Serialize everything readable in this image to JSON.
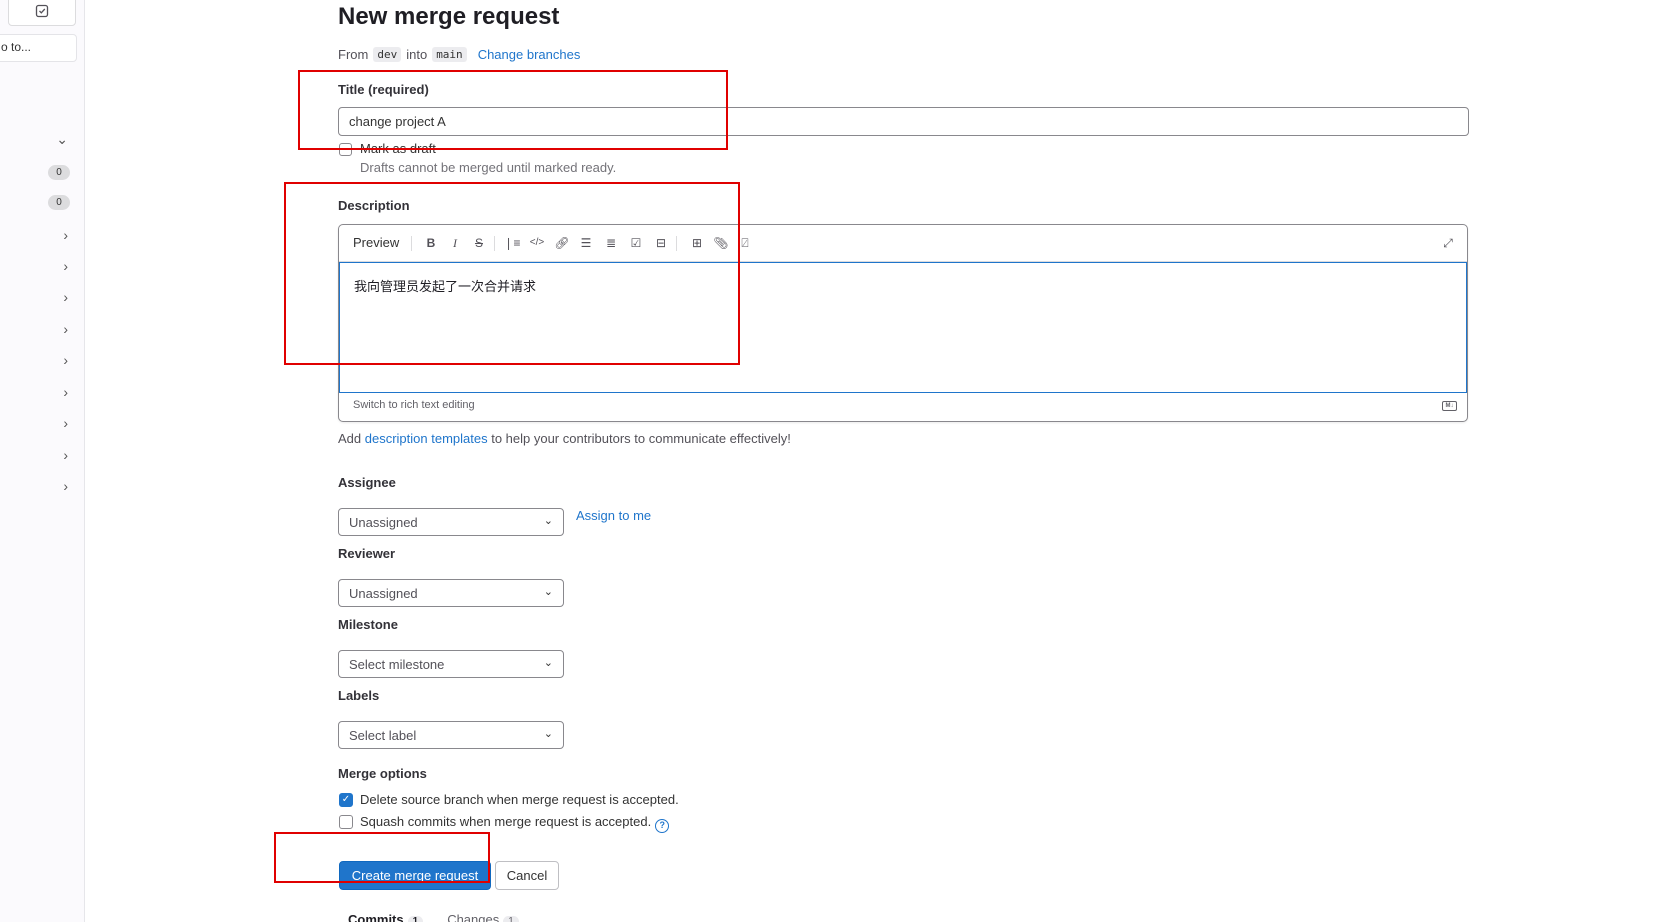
{
  "sidebar": {
    "search_text": "o to...",
    "badges": [
      "0",
      "0"
    ]
  },
  "header": {
    "title": "New merge request",
    "from_label": "From",
    "source_branch": "dev",
    "into_label": "into",
    "target_branch": "main",
    "change_branches": "Change branches"
  },
  "form": {
    "title_label": "Title (required)",
    "title_value": "change project A",
    "draft_label": "Mark as draft",
    "draft_help": "Drafts cannot be merged until marked ready.",
    "description_label": "Description",
    "preview_label": "Preview",
    "description_value": "我向管理员发起了一次合并请求",
    "switch_rich_text": "Switch to rich text editing",
    "md_badge": "M↓",
    "add_desc_prefix": "Add ",
    "add_desc_link": "description templates",
    "add_desc_suffix": " to help your contributors to communicate effectively!",
    "assignee_label": "Assignee",
    "assignee_value": "Unassigned",
    "assign_to_me": "Assign to me",
    "reviewer_label": "Reviewer",
    "reviewer_value": "Unassigned",
    "milestone_label": "Milestone",
    "milestone_value": "Select milestone",
    "labels_label": "Labels",
    "labels_value": "Select label",
    "merge_options_label": "Merge options",
    "delete_branch_label": "Delete source branch when merge request is accepted.",
    "delete_branch_checked": true,
    "squash_label": "Squash commits when merge request is accepted.",
    "squash_checked": false
  },
  "actions": {
    "create_label": "Create merge request",
    "cancel_label": "Cancel"
  },
  "tabs": [
    {
      "label": "Commits",
      "count": "1"
    },
    {
      "label": "Changes",
      "count": "1"
    }
  ],
  "colors": {
    "accent": "#1f75cb",
    "annotation": "#e00000"
  }
}
